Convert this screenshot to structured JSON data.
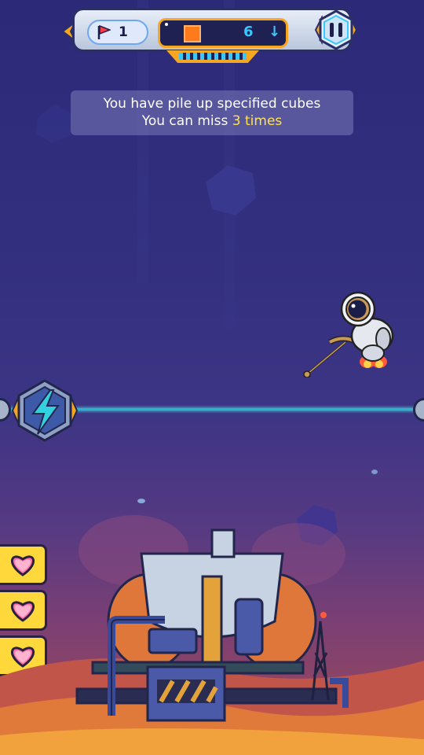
{
  "hud": {
    "level": "1",
    "cube_count": "6",
    "colors": {
      "accent": "#f7a623",
      "cube": "#ff7a1a",
      "counter": "#38c8ff"
    }
  },
  "message": {
    "line1": "You have pile up specified cubes",
    "line2_prefix": "You can miss ",
    "line2_highlight": "3 times"
  },
  "lives": {
    "count": 3,
    "icon": "heart-icon"
  }
}
